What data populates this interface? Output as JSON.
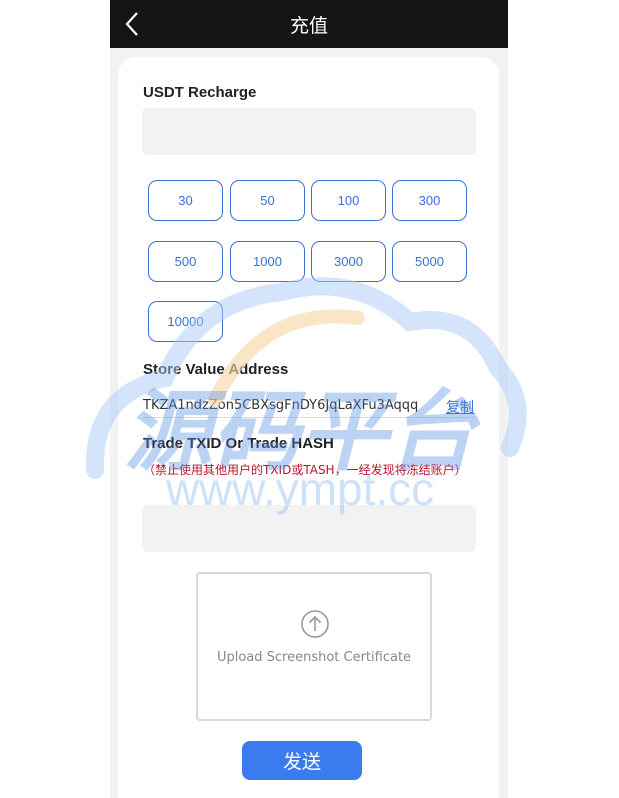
{
  "header": {
    "title": "充值",
    "back_icon": "chevron-left-icon"
  },
  "recharge": {
    "label": "USDT Recharge",
    "amount_value": "",
    "amounts": [
      "30",
      "50",
      "100",
      "300",
      "500",
      "1000",
      "3000",
      "5000",
      "10000"
    ]
  },
  "address": {
    "label": "Store Value Address",
    "value": "TKZA1ndzZon5CBXsgFnDY6JqLaXFu3Aqqq",
    "copy_label": "复制"
  },
  "trade": {
    "label": "Trade TXID Or Trade HASH",
    "warning": "（禁止使用其他用户的TXID或TASH，一经发现将冻结账户）",
    "value": ""
  },
  "upload": {
    "label": "Upload Screenshot Certificate",
    "icon": "arrow-up-circle-icon"
  },
  "submit_label": "发送",
  "watermark": {
    "line1": "源码平台",
    "line2": "www.ympt.cc"
  },
  "colors": {
    "accent": "#3a7bf0",
    "warning": "#b8142b",
    "header_bg": "#151515"
  }
}
